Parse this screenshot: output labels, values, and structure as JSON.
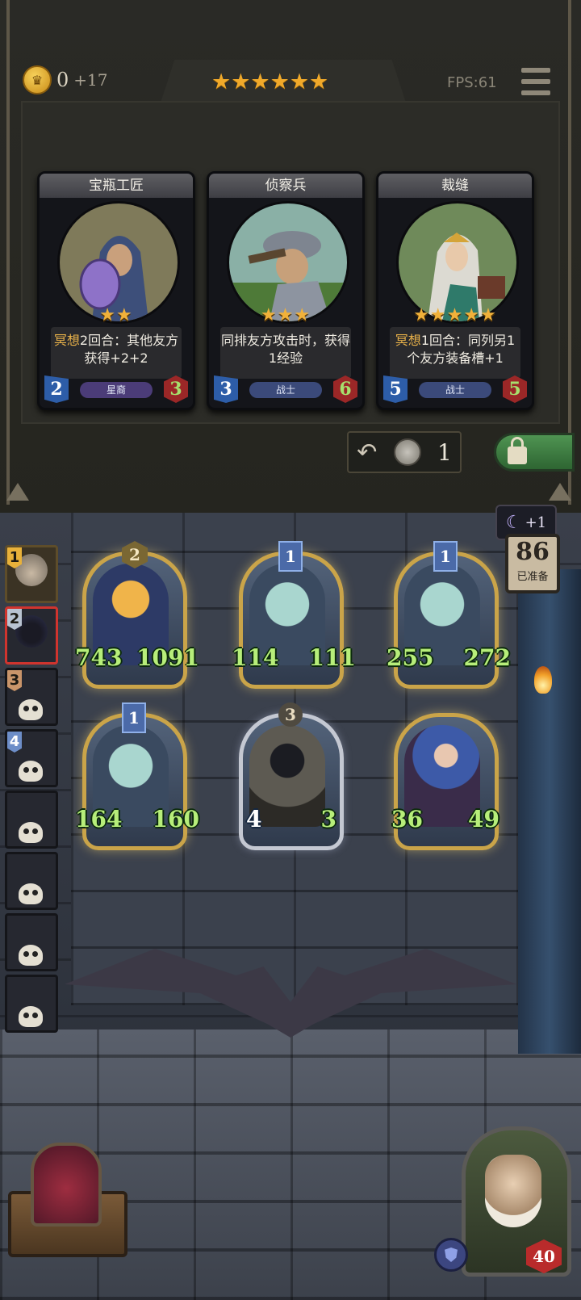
{
  "header": {
    "gold": "0",
    "gold_income": "+17",
    "tier_stars": "★★★★★★",
    "fps": "FPS:61"
  },
  "shop": {
    "cards": [
      {
        "name": "宝瓶工匠",
        "stars": "★★",
        "text_keyword": "冥想",
        "text_rest": "2回合：其他友方获得+2+2",
        "tribe": "星裔",
        "attack": "2",
        "health": "3"
      },
      {
        "name": "侦察兵",
        "stars": "★★★",
        "text_keyword": "",
        "text_rest": "同排友方攻击时，获得1经验",
        "tribe": "战士",
        "attack": "3",
        "health": "6"
      },
      {
        "name": "裁缝",
        "stars": "★★★★★",
        "text_keyword": "冥想",
        "text_rest": "1回合：同列另1个友方装备槽+1",
        "tribe": "战士",
        "attack": "5",
        "health": "5"
      }
    ],
    "refresh_cost": "1"
  },
  "lineup": {
    "slots": [
      {
        "num": "1"
      },
      {
        "num": "2"
      },
      {
        "num": "3"
      },
      {
        "num": "4"
      }
    ]
  },
  "turn": {
    "moon_bonus": "+1",
    "ready_count": "86",
    "ready_label": "已准备"
  },
  "board": {
    "minions": [
      {
        "tier": "2",
        "attack": "743",
        "health": "1091"
      },
      {
        "tier": "1",
        "attack": "114",
        "health": "111"
      },
      {
        "tier": "1",
        "attack": "255",
        "health": "272"
      },
      {
        "tier": "1",
        "attack": "164",
        "health": "160"
      },
      {
        "tier": "3",
        "attack": "4",
        "health": "3"
      },
      {
        "tier": "",
        "attack": "36",
        "health": "49"
      }
    ]
  },
  "hero": {
    "health": "40"
  },
  "colors": {
    "gold_accent": "#f0a92a",
    "panel_bg": "#2a2a26",
    "freeze_green": "#4f9452",
    "health_red": "#b92b2b"
  }
}
